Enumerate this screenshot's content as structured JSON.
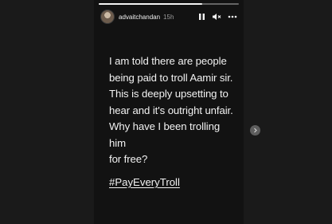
{
  "story": {
    "username": "advaitchandan",
    "timestamp": "15h",
    "progress": 0.74,
    "text": "I am told there are people being paid to troll Aamir sir. This is deeply upsetting to hear and it's outright unfair. Why have I been trolling him for free?",
    "hashtag": "#PayEveryTroll"
  },
  "icons": {
    "pause": "pause-icon",
    "mute": "muted-speaker-icon",
    "more": "more-options-icon",
    "next": "chevron-right-icon"
  }
}
